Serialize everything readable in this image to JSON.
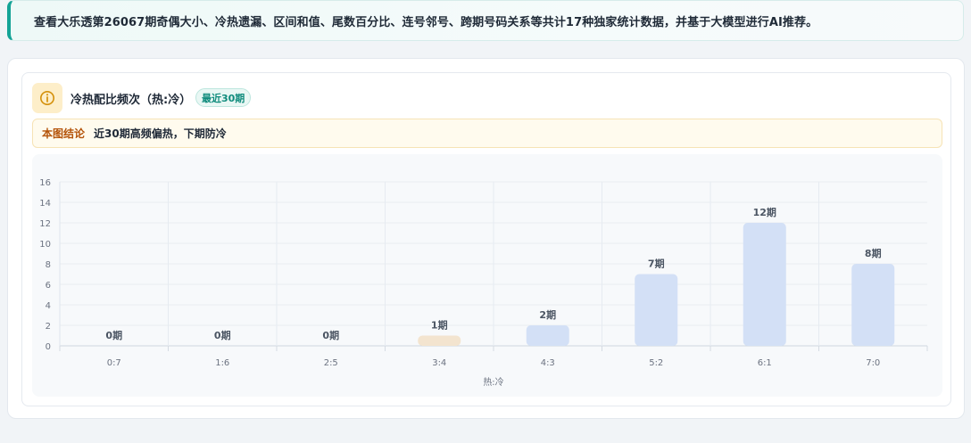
{
  "banner": {
    "text": "查看大乐透第26067期奇偶大小、冷热遗漏、区间和值、尾数百分比、连号邻号、跨期号码关系等共计17种独家统计数据，并基于大模型进行AI推荐。"
  },
  "card": {
    "icon": "info-icon",
    "title": "冷热配比频次（热:冷）",
    "badge": "最近30期",
    "conclusion_tag": "本图结论",
    "conclusion_text": "近30期高频偏热，下期防冷"
  },
  "colors": {
    "accent": "#14a396",
    "bar_default": "#d3e0f6",
    "bar_highlight": "#f3e4cf",
    "icon_bg": "#fdeec9",
    "icon_fg": "#d4900a"
  },
  "chart_data": {
    "type": "bar",
    "title": "",
    "xlabel": "热:冷",
    "ylabel": "",
    "categories": [
      "0:7",
      "1:6",
      "2:5",
      "3:4",
      "4:3",
      "5:2",
      "6:1",
      "7:0"
    ],
    "values": [
      0,
      0,
      0,
      1,
      2,
      7,
      12,
      8
    ],
    "data_labels": [
      "0期",
      "0期",
      "0期",
      "1期",
      "2期",
      "7期",
      "12期",
      "8期"
    ],
    "highlight_category": "3:4",
    "ylim": [
      0,
      16
    ],
    "yticks": [
      0,
      2,
      4,
      6,
      8,
      10,
      12,
      14,
      16
    ],
    "grid": true,
    "legend": "none"
  }
}
